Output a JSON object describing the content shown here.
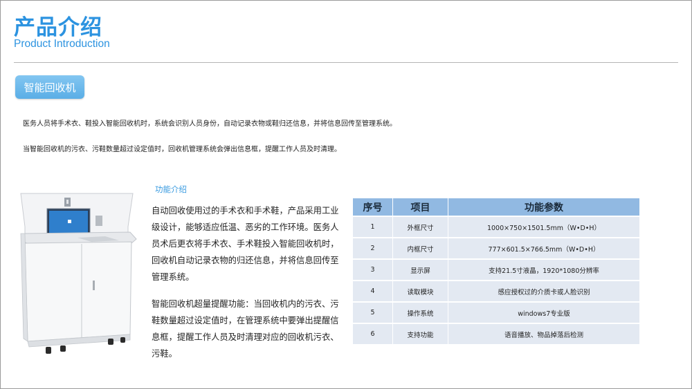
{
  "header": {
    "title_zh": "产品介绍",
    "title_en": "Product Introduction"
  },
  "section_button": {
    "label": "智能回收机"
  },
  "intro": {
    "line1": "医务人员将手术衣、鞋投入智能回收机时，系统会识别人员身份，自动记录衣物或鞋归还信息，并将信息回传至管理系统。",
    "line2": "当智能回收机的污衣、污鞋数量超过设定值时，回收机管理系统会弹出信息框，提醒工作人员及时清理。"
  },
  "features": {
    "title": "功能介绍",
    "para1": "自动回收使用过的手术衣和手术鞋，产品采用工业级设计，能够适应低温、恶劣的工作环境。医务人员术后更衣将手术衣、手术鞋投入智能回收机时，回收机自动记录衣物的归还信息，并将信息回传至管理系统。",
    "para2": "智能回收机超量提醒功能：当回收机内的污衣、污鞋数量超过设定值时，在管理系统中要弹出提醒信息框，提醒工作人员及时清理对应的回收机污衣、污鞋。"
  },
  "spec_table": {
    "headers": [
      "序号",
      "项目",
      "功能参数"
    ],
    "rows": [
      [
        "1",
        "外框尺寸",
        "1000×750×1501.5mm（W•D•H）"
      ],
      [
        "2",
        "内框尺寸",
        "777×601.5×766.5mm（W•D•H）"
      ],
      [
        "3",
        "显示屏",
        "支持21.5寸液晶，1920*1080分辨率"
      ],
      [
        "4",
        "读取模块",
        "感应授权过的介质卡或人脸识别"
      ],
      [
        "5",
        "操作系统",
        "windows7专业版"
      ],
      [
        "6",
        "支持功能",
        "语音播放、物品掉落后检测"
      ]
    ]
  },
  "colors": {
    "accent": "#2c93e0",
    "button": "#5aaee6",
    "table_header": "#91b9e2",
    "table_row": "#e3e9f2"
  }
}
